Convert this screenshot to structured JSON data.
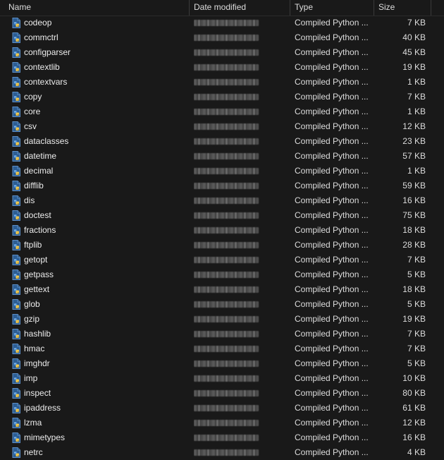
{
  "columns": {
    "name": "Name",
    "date_modified": "Date modified",
    "type": "Type",
    "size": "Size"
  },
  "colors": {
    "background": "#191919",
    "text": "#e6e6e6",
    "icon_blue": "#3a76b8",
    "icon_yellow": "#f2c94c"
  },
  "icon": "python-compiled-file-icon",
  "files": [
    {
      "name": "codeop",
      "type": "Compiled Python ...",
      "size": "7 KB"
    },
    {
      "name": "commctrl",
      "type": "Compiled Python ...",
      "size": "40 KB"
    },
    {
      "name": "configparser",
      "type": "Compiled Python ...",
      "size": "45 KB"
    },
    {
      "name": "contextlib",
      "type": "Compiled Python ...",
      "size": "19 KB"
    },
    {
      "name": "contextvars",
      "type": "Compiled Python ...",
      "size": "1 KB"
    },
    {
      "name": "copy",
      "type": "Compiled Python ...",
      "size": "7 KB"
    },
    {
      "name": "core",
      "type": "Compiled Python ...",
      "size": "1 KB"
    },
    {
      "name": "csv",
      "type": "Compiled Python ...",
      "size": "12 KB"
    },
    {
      "name": "dataclasses",
      "type": "Compiled Python ...",
      "size": "23 KB"
    },
    {
      "name": "datetime",
      "type": "Compiled Python ...",
      "size": "57 KB"
    },
    {
      "name": "decimal",
      "type": "Compiled Python ...",
      "size": "1 KB"
    },
    {
      "name": "difflib",
      "type": "Compiled Python ...",
      "size": "59 KB"
    },
    {
      "name": "dis",
      "type": "Compiled Python ...",
      "size": "16 KB"
    },
    {
      "name": "doctest",
      "type": "Compiled Python ...",
      "size": "75 KB"
    },
    {
      "name": "fractions",
      "type": "Compiled Python ...",
      "size": "18 KB"
    },
    {
      "name": "ftplib",
      "type": "Compiled Python ...",
      "size": "28 KB"
    },
    {
      "name": "getopt",
      "type": "Compiled Python ...",
      "size": "7 KB"
    },
    {
      "name": "getpass",
      "type": "Compiled Python ...",
      "size": "5 KB"
    },
    {
      "name": "gettext",
      "type": "Compiled Python ...",
      "size": "18 KB"
    },
    {
      "name": "glob",
      "type": "Compiled Python ...",
      "size": "5 KB"
    },
    {
      "name": "gzip",
      "type": "Compiled Python ...",
      "size": "19 KB"
    },
    {
      "name": "hashlib",
      "type": "Compiled Python ...",
      "size": "7 KB"
    },
    {
      "name": "hmac",
      "type": "Compiled Python ...",
      "size": "7 KB"
    },
    {
      "name": "imghdr",
      "type": "Compiled Python ...",
      "size": "5 KB"
    },
    {
      "name": "imp",
      "type": "Compiled Python ...",
      "size": "10 KB"
    },
    {
      "name": "inspect",
      "type": "Compiled Python ...",
      "size": "80 KB"
    },
    {
      "name": "ipaddress",
      "type": "Compiled Python ...",
      "size": "61 KB"
    },
    {
      "name": "lzma",
      "type": "Compiled Python ...",
      "size": "12 KB"
    },
    {
      "name": "mimetypes",
      "type": "Compiled Python ...",
      "size": "16 KB"
    },
    {
      "name": "netrc",
      "type": "Compiled Python ...",
      "size": "4 KB"
    }
  ]
}
